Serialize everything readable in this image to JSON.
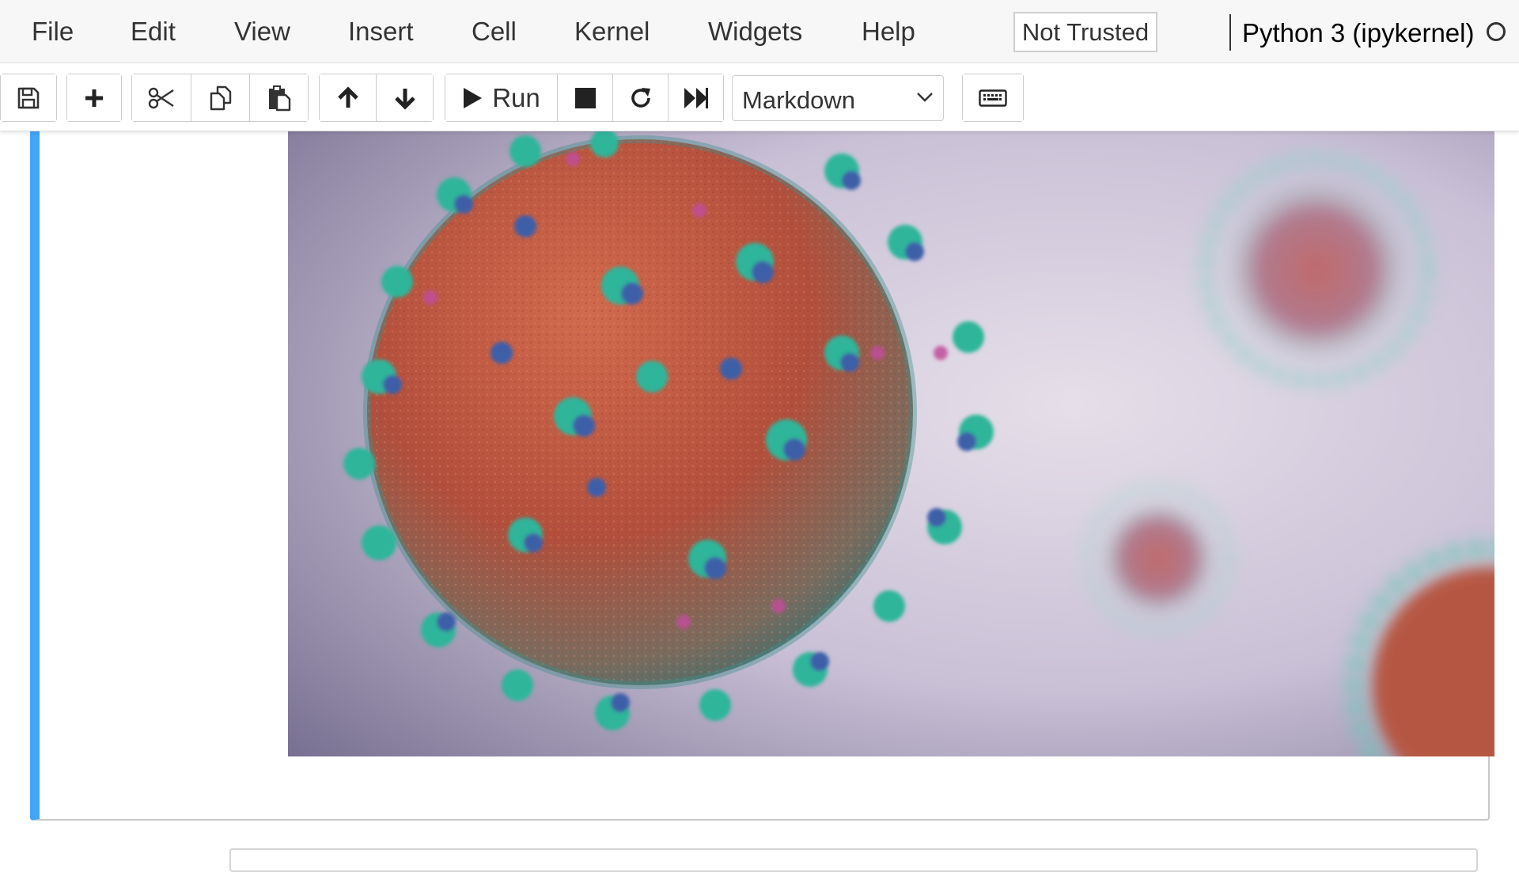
{
  "menubar": {
    "items": [
      {
        "label": "File"
      },
      {
        "label": "Edit"
      },
      {
        "label": "View"
      },
      {
        "label": "Insert"
      },
      {
        "label": "Cell"
      },
      {
        "label": "Kernel"
      },
      {
        "label": "Widgets"
      },
      {
        "label": "Help"
      }
    ],
    "trust_badge": "Not Trusted",
    "kernel_name": "Python 3 (ipykernel)",
    "kernel_status_icon": "circle-outline-icon"
  },
  "toolbar": {
    "icons": {
      "save": "floppy-disk-icon",
      "insert_cell": "plus-icon",
      "cut": "scissors-icon",
      "copy": "copy-icon",
      "paste": "paste-icon",
      "move_up": "arrow-up-icon",
      "move_down": "arrow-down-icon",
      "run": "play-icon",
      "interrupt": "stop-icon",
      "restart": "refresh-icon",
      "run_all": "fast-forward-icon",
      "command_palette": "keyboard-icon"
    },
    "run_label": "Run",
    "cell_type": {
      "selected": "Markdown"
    }
  },
  "notebook": {
    "cell": {
      "type": "markdown-rendered",
      "image": "coronavirus-particles-render"
    }
  },
  "colors": {
    "selected_cell_bar": "#42a5f5",
    "menubar_bg": "#f7f7f7"
  }
}
